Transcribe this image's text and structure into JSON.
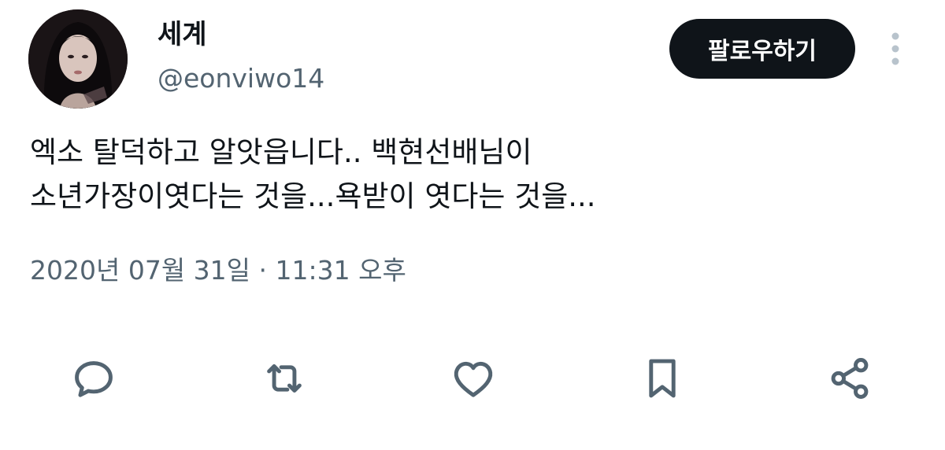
{
  "user": {
    "display_name": "세계",
    "handle": "@eonviwo14"
  },
  "follow_button": {
    "label": "팔로우하기"
  },
  "tweet": {
    "lines": [
      "엑소 탈덕하고 알앗읍니다.. 백현선배님이",
      "소년가장이엿다는 것을...욕받이 엿다는 것을..."
    ],
    "timestamp": "2020년 07월 31일 · 11:31 오후"
  },
  "actions": [
    {
      "icon": "reply-icon"
    },
    {
      "icon": "retweet-icon"
    },
    {
      "icon": "like-icon"
    },
    {
      "icon": "bookmark-icon"
    },
    {
      "icon": "share-icon"
    }
  ],
  "colors": {
    "text_primary": "#0f1419",
    "text_secondary": "#536471",
    "button_bg": "#0f1419",
    "button_text": "#ffffff"
  }
}
